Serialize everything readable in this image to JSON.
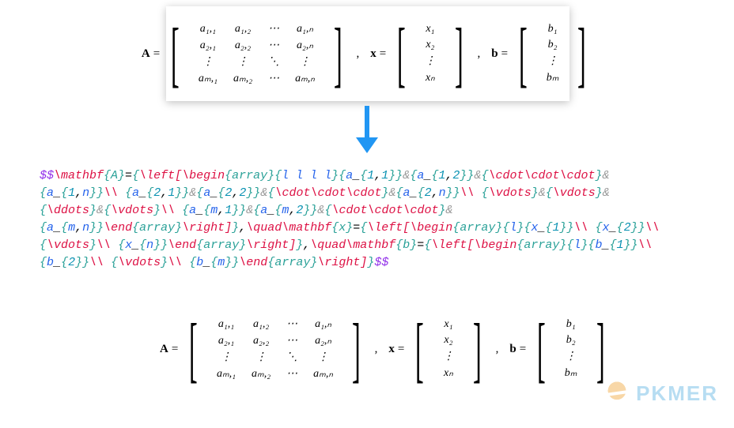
{
  "matrix_A": {
    "label": "A",
    "rows": [
      [
        "a₁,₁",
        "a₁,₂",
        "⋯",
        "a₁,ₙ"
      ],
      [
        "a₂,₁",
        "a₂,₂",
        "⋯",
        "a₂,ₙ"
      ],
      [
        "⋮",
        "⋮",
        "⋱",
        "⋮"
      ],
      [
        "aₘ,₁",
        "aₘ,₂",
        "⋯",
        "aₘ,ₙ"
      ]
    ]
  },
  "vector_x": {
    "label": "x",
    "entries": [
      "x₁",
      "x₂",
      "⋮",
      "xₙ"
    ]
  },
  "vector_b": {
    "label": "b",
    "entries": [
      "b₁",
      "b₂",
      "⋮",
      "bₘ"
    ]
  },
  "latex_tokens": [
    [
      "p",
      "$$"
    ],
    [
      "rd",
      "\\mathbf"
    ],
    [
      "tl",
      "{A}"
    ],
    [
      "",
      "="
    ],
    [
      "tl",
      "{"
    ],
    [
      "rd",
      "\\left["
    ],
    [
      "rd",
      "\\begin"
    ],
    [
      "tl",
      "{array}"
    ],
    [
      "tl",
      "{"
    ],
    [
      "bl",
      "l l l l"
    ],
    [
      "tl",
      "}"
    ],
    [
      "tl",
      "{"
    ],
    [
      "bl",
      "a"
    ],
    [
      "",
      "_"
    ],
    [
      "tl",
      "{"
    ],
    [
      "cy",
      "1"
    ],
    [
      "",
      ","
    ],
    [
      "cy",
      "1"
    ],
    [
      "tl",
      "}}"
    ],
    [
      "gr",
      "&"
    ],
    [
      "tl",
      "{"
    ],
    [
      "bl",
      "a"
    ],
    [
      "",
      "_"
    ],
    [
      "tl",
      "{"
    ],
    [
      "cy",
      "1"
    ],
    [
      "",
      ","
    ],
    [
      "cy",
      "2"
    ],
    [
      "tl",
      "}}"
    ],
    [
      "gr",
      "&"
    ],
    [
      "tl",
      "{"
    ],
    [
      "rd",
      "\\cdot\\cdot\\cdot"
    ],
    [
      "tl",
      "}"
    ],
    [
      "gr",
      "&"
    ],
    [
      "nl",
      ""
    ],
    [
      "tl",
      "{"
    ],
    [
      "bl",
      "a"
    ],
    [
      "",
      "_"
    ],
    [
      "tl",
      "{"
    ],
    [
      "cy",
      "1"
    ],
    [
      "",
      ","
    ],
    [
      "bl",
      "n"
    ],
    [
      "tl",
      "}}"
    ],
    [
      "rd",
      "\\\\"
    ],
    [
      "",
      " "
    ],
    [
      "tl",
      "{"
    ],
    [
      "bl",
      "a"
    ],
    [
      "",
      "_"
    ],
    [
      "tl",
      "{"
    ],
    [
      "cy",
      "2"
    ],
    [
      "",
      ","
    ],
    [
      "cy",
      "1"
    ],
    [
      "tl",
      "}}"
    ],
    [
      "gr",
      "&"
    ],
    [
      "tl",
      "{"
    ],
    [
      "bl",
      "a"
    ],
    [
      "",
      "_"
    ],
    [
      "tl",
      "{"
    ],
    [
      "cy",
      "2"
    ],
    [
      "",
      ","
    ],
    [
      "cy",
      "2"
    ],
    [
      "tl",
      "}}"
    ],
    [
      "gr",
      "&"
    ],
    [
      "tl",
      "{"
    ],
    [
      "rd",
      "\\cdot\\cdot\\cdot"
    ],
    [
      "tl",
      "}"
    ],
    [
      "gr",
      "&"
    ],
    [
      "tl",
      "{"
    ],
    [
      "bl",
      "a"
    ],
    [
      "",
      "_"
    ],
    [
      "tl",
      "{"
    ],
    [
      "cy",
      "2"
    ],
    [
      "",
      ","
    ],
    [
      "bl",
      "n"
    ],
    [
      "tl",
      "}}"
    ],
    [
      "rd",
      "\\\\"
    ],
    [
      "",
      " "
    ],
    [
      "tl",
      "{"
    ],
    [
      "rd",
      "\\vdots"
    ],
    [
      "tl",
      "}"
    ],
    [
      "gr",
      "&"
    ],
    [
      "tl",
      "{"
    ],
    [
      "rd",
      "\\vdots"
    ],
    [
      "tl",
      "}"
    ],
    [
      "gr",
      "&"
    ],
    [
      "nl",
      ""
    ],
    [
      "tl",
      "{"
    ],
    [
      "rd",
      "\\ddots"
    ],
    [
      "tl",
      "}"
    ],
    [
      "gr",
      "&"
    ],
    [
      "tl",
      "{"
    ],
    [
      "rd",
      "\\vdots"
    ],
    [
      "tl",
      "}"
    ],
    [
      "rd",
      "\\\\"
    ],
    [
      "",
      " "
    ],
    [
      "tl",
      "{"
    ],
    [
      "bl",
      "a"
    ],
    [
      "",
      "_"
    ],
    [
      "tl",
      "{"
    ],
    [
      "bl",
      "m"
    ],
    [
      "",
      ","
    ],
    [
      "cy",
      "1"
    ],
    [
      "tl",
      "}}"
    ],
    [
      "gr",
      "&"
    ],
    [
      "tl",
      "{"
    ],
    [
      "bl",
      "a"
    ],
    [
      "",
      "_"
    ],
    [
      "tl",
      "{"
    ],
    [
      "bl",
      "m"
    ],
    [
      "",
      ","
    ],
    [
      "cy",
      "2"
    ],
    [
      "tl",
      "}}"
    ],
    [
      "gr",
      "&"
    ],
    [
      "tl",
      "{"
    ],
    [
      "rd",
      "\\cdot\\cdot\\cdot"
    ],
    [
      "tl",
      "}"
    ],
    [
      "gr",
      "&"
    ],
    [
      "nl",
      ""
    ],
    [
      "tl",
      "{"
    ],
    [
      "bl",
      "a"
    ],
    [
      "",
      "_"
    ],
    [
      "tl",
      "{"
    ],
    [
      "bl",
      "m"
    ],
    [
      "",
      ","
    ],
    [
      "bl",
      "n"
    ],
    [
      "tl",
      "}}"
    ],
    [
      "rd",
      "\\end"
    ],
    [
      "tl",
      "{array}"
    ],
    [
      "rd",
      "\\right]"
    ],
    [
      "tl",
      "}"
    ],
    [
      "",
      ","
    ],
    [
      "rd",
      "\\quad\\mathbf"
    ],
    [
      "tl",
      "{x}"
    ],
    [
      "",
      "="
    ],
    [
      "tl",
      "{"
    ],
    [
      "rd",
      "\\left["
    ],
    [
      "rd",
      "\\begin"
    ],
    [
      "tl",
      "{array}"
    ],
    [
      "tl",
      "{"
    ],
    [
      "bl",
      "l"
    ],
    [
      "tl",
      "}"
    ],
    [
      "tl",
      "{"
    ],
    [
      "bl",
      "x"
    ],
    [
      "",
      "_"
    ],
    [
      "tl",
      "{"
    ],
    [
      "cy",
      "1"
    ],
    [
      "tl",
      "}}"
    ],
    [
      "rd",
      "\\\\"
    ],
    [
      "",
      " "
    ],
    [
      "tl",
      "{"
    ],
    [
      "bl",
      "x"
    ],
    [
      "",
      "_"
    ],
    [
      "tl",
      "{"
    ],
    [
      "cy",
      "2"
    ],
    [
      "tl",
      "}}"
    ],
    [
      "rd",
      "\\\\"
    ],
    [
      "nl",
      ""
    ],
    [
      "tl",
      "{"
    ],
    [
      "rd",
      "\\vdots"
    ],
    [
      "tl",
      "}"
    ],
    [
      "rd",
      "\\\\"
    ],
    [
      "",
      " "
    ],
    [
      "tl",
      "{"
    ],
    [
      "bl",
      "x"
    ],
    [
      "",
      "_"
    ],
    [
      "tl",
      "{"
    ],
    [
      "bl",
      "n"
    ],
    [
      "tl",
      "}}"
    ],
    [
      "rd",
      "\\end"
    ],
    [
      "tl",
      "{array}"
    ],
    [
      "rd",
      "\\right]"
    ],
    [
      "tl",
      "}"
    ],
    [
      "",
      ","
    ],
    [
      "rd",
      "\\quad\\mathbf"
    ],
    [
      "tl",
      "{b}"
    ],
    [
      "",
      "="
    ],
    [
      "tl",
      "{"
    ],
    [
      "rd",
      "\\left["
    ],
    [
      "rd",
      "\\begin"
    ],
    [
      "tl",
      "{array}"
    ],
    [
      "tl",
      "{"
    ],
    [
      "bl",
      "l"
    ],
    [
      "tl",
      "}"
    ],
    [
      "tl",
      "{"
    ],
    [
      "bl",
      "b"
    ],
    [
      "",
      "_"
    ],
    [
      "tl",
      "{"
    ],
    [
      "cy",
      "1"
    ],
    [
      "tl",
      "}}"
    ],
    [
      "rd",
      "\\\\"
    ],
    [
      "nl",
      ""
    ],
    [
      "tl",
      "{"
    ],
    [
      "bl",
      "b"
    ],
    [
      "",
      "_"
    ],
    [
      "tl",
      "{"
    ],
    [
      "cy",
      "2"
    ],
    [
      "tl",
      "}}"
    ],
    [
      "rd",
      "\\\\"
    ],
    [
      "",
      " "
    ],
    [
      "tl",
      "{"
    ],
    [
      "rd",
      "\\vdots"
    ],
    [
      "tl",
      "}"
    ],
    [
      "rd",
      "\\\\"
    ],
    [
      "",
      " "
    ],
    [
      "tl",
      "{"
    ],
    [
      "bl",
      "b"
    ],
    [
      "",
      "_"
    ],
    [
      "tl",
      "{"
    ],
    [
      "bl",
      "m"
    ],
    [
      "tl",
      "}}"
    ],
    [
      "rd",
      "\\end"
    ],
    [
      "tl",
      "{array}"
    ],
    [
      "rd",
      "\\right]"
    ],
    [
      "tl",
      "}"
    ],
    [
      "p",
      "$$"
    ]
  ],
  "watermark": "PKMER"
}
